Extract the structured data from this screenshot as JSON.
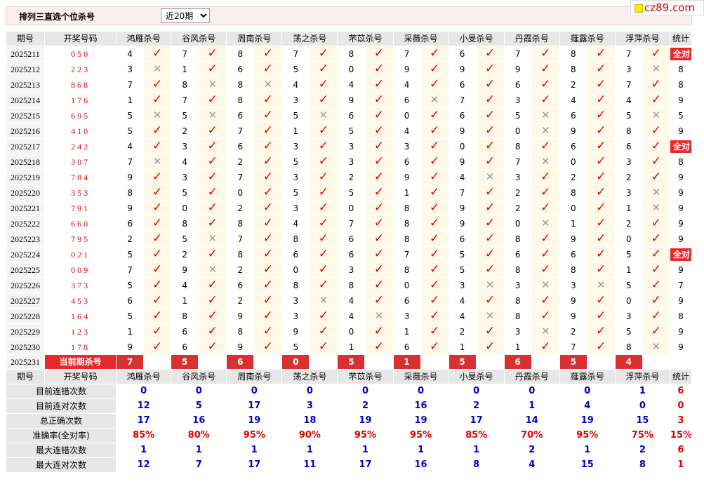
{
  "page_title": "排列三直选个位杀号",
  "period_select": {
    "selected": "近20期",
    "options": [
      "近20期"
    ]
  },
  "logo": "cz89.com",
  "headers": {
    "issue": "期号",
    "code": "开奖号码",
    "stat": "统计"
  },
  "experts": [
    "鸿雁杀号",
    "谷风杀号",
    "周南杀号",
    "荡之杀号",
    "芣苡杀号",
    "采薇杀号",
    "小旻杀号",
    "丹霞杀号",
    "薤露杀号",
    "浮萍杀号"
  ],
  "rows": [
    {
      "issue": "2025211",
      "code": "050",
      "kills": [
        [
          4,
          1
        ],
        [
          7,
          1
        ],
        [
          8,
          1
        ],
        [
          7,
          1
        ],
        [
          8,
          1
        ],
        [
          7,
          1
        ],
        [
          6,
          1
        ],
        [
          7,
          1
        ],
        [
          8,
          1
        ],
        [
          7,
          1
        ]
      ],
      "stat": "全对"
    },
    {
      "issue": "2025212",
      "code": "223",
      "kills": [
        [
          3,
          0
        ],
        [
          1,
          1
        ],
        [
          6,
          1
        ],
        [
          5,
          1
        ],
        [
          0,
          1
        ],
        [
          9,
          1
        ],
        [
          9,
          1
        ],
        [
          9,
          1
        ],
        [
          8,
          1
        ],
        [
          3,
          0
        ]
      ],
      "stat": "8"
    },
    {
      "issue": "2025213",
      "code": "868",
      "kills": [
        [
          7,
          1
        ],
        [
          8,
          0
        ],
        [
          8,
          0
        ],
        [
          4,
          1
        ],
        [
          4,
          1
        ],
        [
          4,
          1
        ],
        [
          6,
          1
        ],
        [
          6,
          1
        ],
        [
          2,
          1
        ],
        [
          7,
          1
        ]
      ],
      "stat": "8"
    },
    {
      "issue": "2025214",
      "code": "176",
      "kills": [
        [
          1,
          1
        ],
        [
          7,
          1
        ],
        [
          8,
          1
        ],
        [
          3,
          1
        ],
        [
          9,
          1
        ],
        [
          6,
          0
        ],
        [
          7,
          1
        ],
        [
          3,
          1
        ],
        [
          4,
          1
        ],
        [
          4,
          1
        ]
      ],
      "stat": "9"
    },
    {
      "issue": "2025215",
      "code": "695",
      "kills": [
        [
          5,
          0
        ],
        [
          5,
          0
        ],
        [
          6,
          1
        ],
        [
          5,
          0
        ],
        [
          6,
          1
        ],
        [
          0,
          1
        ],
        [
          6,
          1
        ],
        [
          5,
          0
        ],
        [
          6,
          1
        ],
        [
          5,
          0
        ]
      ],
      "stat": "5"
    },
    {
      "issue": "2025216",
      "code": "410",
      "kills": [
        [
          5,
          1
        ],
        [
          2,
          1
        ],
        [
          7,
          1
        ],
        [
          1,
          1
        ],
        [
          5,
          1
        ],
        [
          4,
          1
        ],
        [
          9,
          1
        ],
        [
          0,
          0
        ],
        [
          9,
          1
        ],
        [
          8,
          1
        ]
      ],
      "stat": "9"
    },
    {
      "issue": "2025217",
      "code": "242",
      "kills": [
        [
          4,
          1
        ],
        [
          3,
          1
        ],
        [
          6,
          1
        ],
        [
          3,
          1
        ],
        [
          3,
          1
        ],
        [
          3,
          1
        ],
        [
          0,
          1
        ],
        [
          8,
          1
        ],
        [
          6,
          1
        ],
        [
          6,
          1
        ]
      ],
      "stat": "全对"
    },
    {
      "issue": "2025218",
      "code": "307",
      "kills": [
        [
          7,
          0
        ],
        [
          4,
          1
        ],
        [
          2,
          1
        ],
        [
          5,
          1
        ],
        [
          3,
          1
        ],
        [
          6,
          1
        ],
        [
          9,
          1
        ],
        [
          7,
          0
        ],
        [
          0,
          1
        ],
        [
          3,
          1
        ]
      ],
      "stat": "8"
    },
    {
      "issue": "2025219",
      "code": "784",
      "kills": [
        [
          9,
          1
        ],
        [
          3,
          1
        ],
        [
          7,
          1
        ],
        [
          3,
          1
        ],
        [
          2,
          1
        ],
        [
          9,
          1
        ],
        [
          4,
          0
        ],
        [
          3,
          1
        ],
        [
          2,
          1
        ],
        [
          2,
          1
        ]
      ],
      "stat": "9"
    },
    {
      "issue": "2025220",
      "code": "353",
      "kills": [
        [
          8,
          1
        ],
        [
          5,
          1
        ],
        [
          0,
          1
        ],
        [
          5,
          1
        ],
        [
          5,
          1
        ],
        [
          1,
          1
        ],
        [
          7,
          1
        ],
        [
          2,
          1
        ],
        [
          8,
          1
        ],
        [
          3,
          0
        ]
      ],
      "stat": "9"
    },
    {
      "issue": "2025221",
      "code": "791",
      "kills": [
        [
          9,
          1
        ],
        [
          0,
          1
        ],
        [
          2,
          1
        ],
        [
          3,
          1
        ],
        [
          0,
          1
        ],
        [
          8,
          1
        ],
        [
          9,
          1
        ],
        [
          2,
          1
        ],
        [
          0,
          1
        ],
        [
          1,
          0
        ]
      ],
      "stat": "9"
    },
    {
      "issue": "2025222",
      "code": "660",
      "kills": [
        [
          6,
          1
        ],
        [
          8,
          1
        ],
        [
          8,
          1
        ],
        [
          4,
          1
        ],
        [
          7,
          1
        ],
        [
          8,
          1
        ],
        [
          9,
          1
        ],
        [
          0,
          0
        ],
        [
          1,
          1
        ],
        [
          2,
          1
        ]
      ],
      "stat": "9"
    },
    {
      "issue": "2025223",
      "code": "795",
      "kills": [
        [
          2,
          1
        ],
        [
          5,
          0
        ],
        [
          7,
          1
        ],
        [
          8,
          1
        ],
        [
          6,
          1
        ],
        [
          8,
          1
        ],
        [
          6,
          1
        ],
        [
          8,
          1
        ],
        [
          9,
          1
        ],
        [
          0,
          1
        ]
      ],
      "stat": "9"
    },
    {
      "issue": "2025224",
      "code": "021",
      "kills": [
        [
          5,
          1
        ],
        [
          2,
          1
        ],
        [
          8,
          1
        ],
        [
          6,
          1
        ],
        [
          6,
          1
        ],
        [
          7,
          1
        ],
        [
          5,
          1
        ],
        [
          6,
          1
        ],
        [
          6,
          1
        ],
        [
          5,
          1
        ]
      ],
      "stat": "全对"
    },
    {
      "issue": "2025225",
      "code": "009",
      "kills": [
        [
          7,
          1
        ],
        [
          9,
          0
        ],
        [
          2,
          1
        ],
        [
          0,
          1
        ],
        [
          3,
          1
        ],
        [
          8,
          1
        ],
        [
          5,
          1
        ],
        [
          8,
          1
        ],
        [
          8,
          1
        ],
        [
          1,
          1
        ]
      ],
      "stat": "9"
    },
    {
      "issue": "2025226",
      "code": "373",
      "kills": [
        [
          5,
          1
        ],
        [
          4,
          1
        ],
        [
          6,
          1
        ],
        [
          8,
          1
        ],
        [
          8,
          1
        ],
        [
          0,
          1
        ],
        [
          3,
          0
        ],
        [
          3,
          0
        ],
        [
          3,
          0
        ],
        [
          5,
          1
        ]
      ],
      "stat": "7"
    },
    {
      "issue": "2025227",
      "code": "453",
      "kills": [
        [
          6,
          1
        ],
        [
          1,
          1
        ],
        [
          2,
          1
        ],
        [
          3,
          0
        ],
        [
          4,
          1
        ],
        [
          6,
          1
        ],
        [
          4,
          1
        ],
        [
          8,
          1
        ],
        [
          9,
          1
        ],
        [
          0,
          1
        ]
      ],
      "stat": "9"
    },
    {
      "issue": "2025228",
      "code": "164",
      "kills": [
        [
          5,
          1
        ],
        [
          8,
          1
        ],
        [
          9,
          1
        ],
        [
          3,
          1
        ],
        [
          4,
          0
        ],
        [
          3,
          1
        ],
        [
          4,
          0
        ],
        [
          8,
          1
        ],
        [
          9,
          1
        ],
        [
          3,
          1
        ]
      ],
      "stat": "8"
    },
    {
      "issue": "2025229",
      "code": "123",
      "kills": [
        [
          1,
          1
        ],
        [
          6,
          1
        ],
        [
          8,
          1
        ],
        [
          9,
          1
        ],
        [
          0,
          1
        ],
        [
          1,
          1
        ],
        [
          2,
          1
        ],
        [
          3,
          0
        ],
        [
          2,
          1
        ],
        [
          5,
          1
        ]
      ],
      "stat": "9"
    },
    {
      "issue": "2025230",
      "code": "178",
      "kills": [
        [
          9,
          1
        ],
        [
          6,
          1
        ],
        [
          9,
          1
        ],
        [
          5,
          1
        ],
        [
          1,
          1
        ],
        [
          6,
          1
        ],
        [
          1,
          1
        ],
        [
          1,
          1
        ],
        [
          7,
          1
        ],
        [
          8,
          0
        ]
      ],
      "stat": "9"
    }
  ],
  "current": {
    "issue": "2025231",
    "label": "当前期杀号",
    "kills": [
      "7",
      "5",
      "6",
      "0",
      "5",
      "1",
      "5",
      "6",
      "5",
      "4"
    ]
  },
  "stats": [
    {
      "label": "目前连错次数",
      "values": [
        "0",
        "0",
        "0",
        "0",
        "0",
        "0",
        "0",
        "0",
        "0",
        "1"
      ],
      "stat": "6"
    },
    {
      "label": "目前连对次数",
      "values": [
        "12",
        "5",
        "17",
        "3",
        "2",
        "16",
        "2",
        "1",
        "4",
        "0"
      ],
      "stat": "0"
    },
    {
      "label": "总正确次数",
      "values": [
        "17",
        "16",
        "19",
        "18",
        "19",
        "19",
        "17",
        "14",
        "19",
        "15"
      ],
      "stat": "3"
    },
    {
      "label": "准确率(全对率)",
      "values": [
        "85%",
        "80%",
        "95%",
        "90%",
        "95%",
        "95%",
        "85%",
        "70%",
        "95%",
        "75%"
      ],
      "stat": "15%"
    },
    {
      "label": "最大连错次数",
      "values": [
        "1",
        "1",
        "1",
        "1",
        "1",
        "1",
        "1",
        "2",
        "1",
        "2"
      ],
      "stat": "6"
    },
    {
      "label": "最大连对次数",
      "values": [
        "12",
        "7",
        "17",
        "11",
        "17",
        "16",
        "8",
        "4",
        "15",
        "8"
      ],
      "stat": "1"
    }
  ],
  "symbols": {
    "right": "✓",
    "wrong": "✕"
  }
}
